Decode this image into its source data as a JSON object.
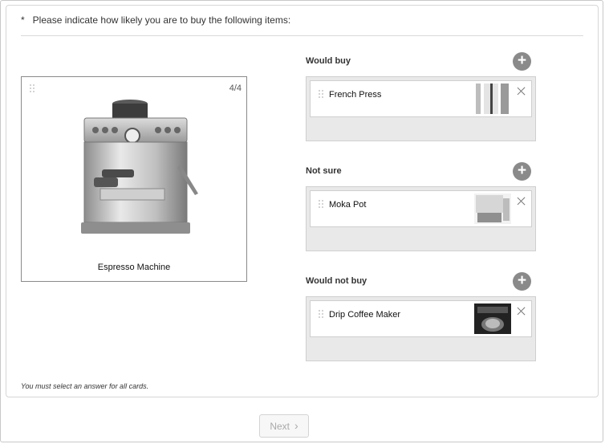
{
  "question": {
    "marker": "*",
    "text": "Please indicate how likely you are to buy the following items:"
  },
  "card": {
    "counter": "4/4",
    "label": "Espresso Machine",
    "image_icon": "espresso-machine-photo"
  },
  "buckets": [
    {
      "title": "Would buy",
      "item": {
        "label": "French Press",
        "thumb": "french-press-photo"
      }
    },
    {
      "title": "Not sure",
      "item": {
        "label": "Moka Pot",
        "thumb": "moka-pot-photo"
      }
    },
    {
      "title": "Would not buy",
      "item": {
        "label": "Drip Coffee Maker",
        "thumb": "drip-coffee-maker-photo"
      }
    }
  ],
  "note": "You must select an answer for all cards.",
  "next": {
    "label": "Next",
    "chevron": "›"
  },
  "colors": {
    "bucket_bg": "#e9e9e9",
    "add_button": "#8a8a8a",
    "border": "#8a8a8a"
  }
}
